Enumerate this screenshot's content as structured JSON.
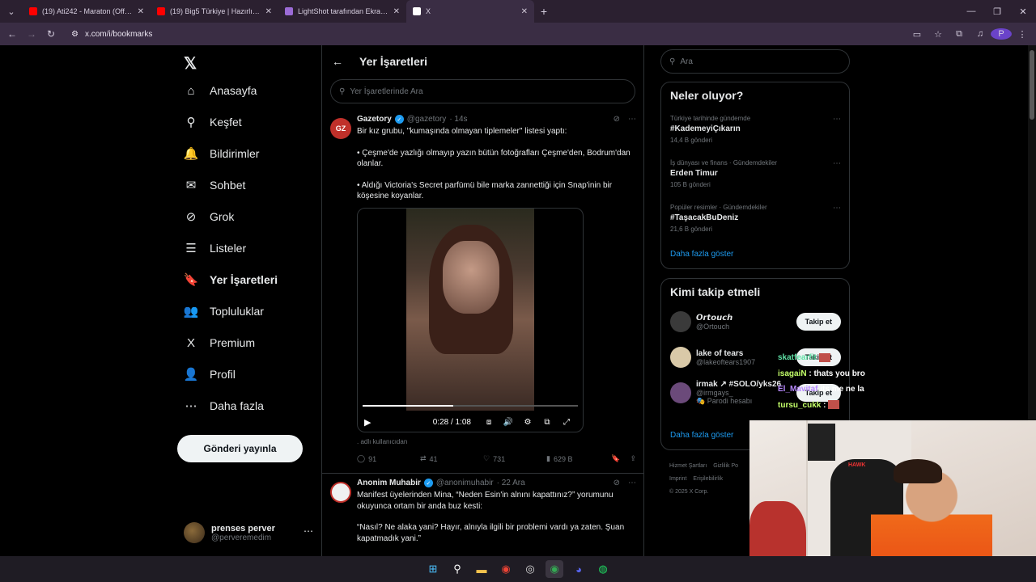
{
  "browser": {
    "tabs": [
      {
        "title": "(19) Ati242 - Maraton (Official V",
        "icon_color": "#ff0000",
        "active": false
      },
      {
        "title": "(19) Big5 Türkiye | Hazırlık Sezo",
        "icon_color": "#ff0000",
        "active": false
      },
      {
        "title": "LightShot tarafından Ekran Görü",
        "icon_color": "#9b6bd6",
        "active": false
      },
      {
        "title": "X",
        "icon_color": "#ffffff",
        "active": true
      }
    ],
    "url": "x.com/i/bookmarks",
    "profile_letter": "P"
  },
  "nav": {
    "items": [
      {
        "label": "Anasayfa",
        "icon": "home-icon",
        "glyph": "⌂"
      },
      {
        "label": "Keşfet",
        "icon": "search-icon",
        "glyph": "⚲"
      },
      {
        "label": "Bildirimler",
        "icon": "bell-icon",
        "glyph": "🔔"
      },
      {
        "label": "Sohbet",
        "icon": "mail-icon",
        "glyph": "✉"
      },
      {
        "label": "Grok",
        "icon": "grok-icon",
        "glyph": "⊘"
      },
      {
        "label": "Listeler",
        "icon": "list-icon",
        "glyph": "☰"
      },
      {
        "label": "Yer İşaretleri",
        "icon": "bookmark-icon",
        "glyph": "🔖"
      },
      {
        "label": "Topluluklar",
        "icon": "communities-icon",
        "glyph": "👥"
      },
      {
        "label": "Premium",
        "icon": "x-premium-icon",
        "glyph": "X"
      },
      {
        "label": "Profil",
        "icon": "profile-icon",
        "glyph": "👤"
      },
      {
        "label": "Daha fazla",
        "icon": "more-circle-icon",
        "glyph": "⋯"
      }
    ],
    "post_button": "Gönderi yayınla",
    "account": {
      "name": "prenses perver",
      "handle": "@perveremedim"
    }
  },
  "main": {
    "title": "Yer İşaretleri",
    "search_placeholder": "Yer İşaretlerinde Ara",
    "tweets": [
      {
        "name": "Gazetory",
        "handle": "@gazetory",
        "time": "· 14s",
        "paragraphs": [
          "Bir kız grubu, \"kumaşında olmayan tiplemeler\" listesi yaptı:",
          "• Çeşme'de yazlığı olmayıp yazın bütün fotoğrafları Çeşme'den, Bodrum'dan olanlar.",
          "•  Aldığı Victoria's Secret parfümü bile marka zannettiği için Snap'inin bir köşesine koyanlar."
        ],
        "video": {
          "time": "0:28 / 1:08",
          "progress": 0.42
        },
        "source_note": ". adlı kullanıcıdan",
        "stats": {
          "replies": "91",
          "reposts": "41",
          "likes": "731",
          "views": "629 B"
        }
      },
      {
        "name": "Anonim Muhabir",
        "handle": "@anonimuhabir",
        "time": "· 22 Ara",
        "paragraphs": [
          "Manifest üyelerinden Mina, “Neden Esin'in alnını kapattınız?” yorumunu okuyunca ortam bir anda buz kesti:",
          "“Nasıl? Ne alaka yani? Hayır, alnıyla ilgili bir problemi vardı ya zaten. Şuan kapatmadık yani.”"
        ]
      }
    ]
  },
  "right": {
    "search_placeholder": "Ara",
    "trends_title": "Neler oluyor?",
    "trends": [
      {
        "context": "Türkiye tarihinde gündemde",
        "tag": "#KademeyiÇıkarın",
        "count": "14,4 B gönderi"
      },
      {
        "context": "İş dünyası ve finans · Gündemdekiler",
        "tag": "Erden Timur",
        "count": "105 B gönderi"
      },
      {
        "context": "Popüler resimler · Gündemdekiler",
        "tag": "#TaşacakBuDeniz",
        "count": "21,6 B gönderi"
      }
    ],
    "show_more": "Daha fazla göster",
    "follow_title": "Kimi takip etmeli",
    "follow": [
      {
        "name": "𝙊𝙧𝙩𝙤𝙪𝙘𝙝",
        "handle": "@Ortouch",
        "sub": "",
        "button": "Takip et"
      },
      {
        "name": "lake of tears",
        "handle": "@lakeoftears1907",
        "sub": "",
        "button": "Takip et"
      },
      {
        "name": "irmak ↗ #SOLO/yks26",
        "handle": "@irmgays_",
        "sub": "🎭 Parodi hesabı",
        "button": "Takip et"
      }
    ],
    "footer": [
      "Hizmet Şartları",
      "Gizlilik Po",
      "Imprint",
      "Erişilebilirlik",
      "© 2025 X Corp."
    ]
  },
  "chat": [
    {
      "user": "skatfearfit",
      "text": "",
      "emote": true
    },
    {
      "user": "isagaiN",
      "text": ": thats you bro",
      "emote": false
    },
    {
      "user": "El_Mavitaf",
      "text": "its me ne la",
      "emote": false
    },
    {
      "user": "tursu_cukk",
      "text": ":",
      "emote": true
    }
  ],
  "webcam": {
    "chair_text": "HAWK"
  },
  "taskbar": [
    {
      "name": "windows-start-icon",
      "glyph": "⊞",
      "cls": "win"
    },
    {
      "name": "search-icon",
      "glyph": "⚲",
      "cls": "search"
    },
    {
      "name": "file-explorer-icon",
      "glyph": "▬",
      "cls": "files"
    },
    {
      "name": "chrome-icon",
      "glyph": "◉",
      "cls": "chrome"
    },
    {
      "name": "obs-icon",
      "glyph": "◎",
      "cls": "obs"
    },
    {
      "name": "chrome-active-icon",
      "glyph": "◉",
      "cls": "chrome2"
    },
    {
      "name": "discord-icon",
      "glyph": "◕",
      "cls": "discord"
    },
    {
      "name": "spotify-icon",
      "glyph": "◍",
      "cls": "spotify"
    }
  ]
}
